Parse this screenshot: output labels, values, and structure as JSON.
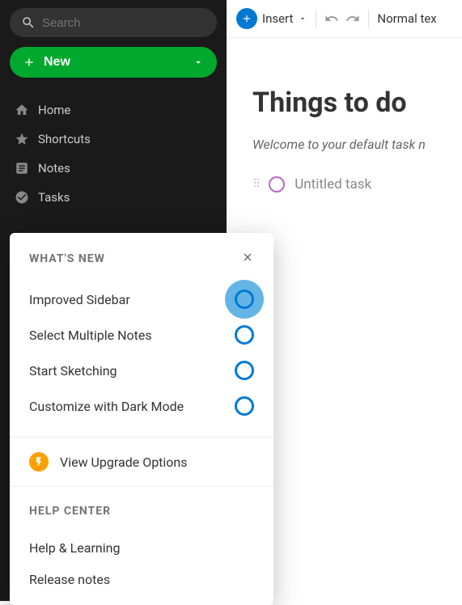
{
  "sidebar": {
    "search_placeholder": "Search",
    "new_label": "New",
    "nav": [
      {
        "label": "Home"
      },
      {
        "label": "Shortcuts"
      },
      {
        "label": "Notes"
      },
      {
        "label": "Tasks"
      }
    ]
  },
  "toolbar": {
    "insert_label": "Insert",
    "text_style": "Normal tex"
  },
  "content": {
    "title": "Things to do",
    "welcome": "Welcome to your default task n",
    "task_placeholder": "Untitled task"
  },
  "popup": {
    "whats_new_heading": "WHAT'S NEW",
    "items": [
      {
        "label": "Improved Sidebar",
        "highlighted": true
      },
      {
        "label": "Select Multiple Notes",
        "highlighted": false
      },
      {
        "label": "Start Sketching",
        "highlighted": false
      },
      {
        "label": "Customize with Dark Mode",
        "highlighted": false
      }
    ],
    "upgrade_label": "View Upgrade Options",
    "help_heading": "HELP CENTER",
    "help_items": [
      {
        "label": "Help & Learning"
      },
      {
        "label": "Release notes"
      }
    ]
  }
}
